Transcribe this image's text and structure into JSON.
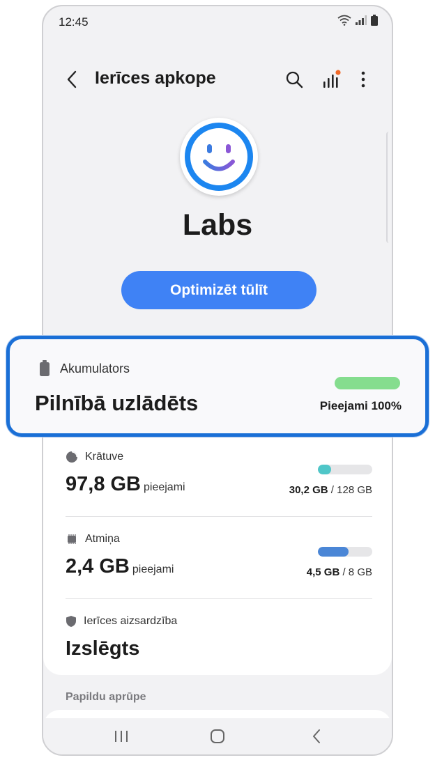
{
  "status_bar": {
    "time": "12:45"
  },
  "app_bar": {
    "title": "Ierīces apkope",
    "icons": [
      "back-icon",
      "search-icon",
      "signal-chart-icon",
      "more-vert-icon"
    ],
    "notification_dot_color": "#f06a2a"
  },
  "hero": {
    "device_name": "Labs",
    "status_icon": "smiley-face-icon",
    "optimize_button": "Optimizēt tūlīt",
    "accent": "#3f82f5"
  },
  "battery": {
    "label": "Akumulators",
    "value": "Pilnībā uzlādēts",
    "available": "Pieejami 100%",
    "fill_fraction": 1.0,
    "bar_color": "#85dd8e"
  },
  "storage": {
    "label": "Krātuve",
    "value": "97,8 GB",
    "value_suffix": "pieejami",
    "used": "30,2 GB",
    "total": "/ 128 GB",
    "fill_fraction": 0.24,
    "bar_color": "#4fc6c8"
  },
  "memory": {
    "label": "Atmiņa",
    "value": "2,4 GB",
    "value_suffix": "pieejami",
    "used": "4,5 GB",
    "total": "/ 8 GB",
    "fill_fraction": 0.56,
    "bar_color": "#4a86d6"
  },
  "protection": {
    "label": "Ierīces aizsardzība",
    "value": "Izslēgts"
  },
  "extra_care": {
    "title": "Papildu aprūpe"
  },
  "nav_bar": {
    "buttons": [
      "recents-icon",
      "home-icon",
      "back-icon"
    ]
  }
}
